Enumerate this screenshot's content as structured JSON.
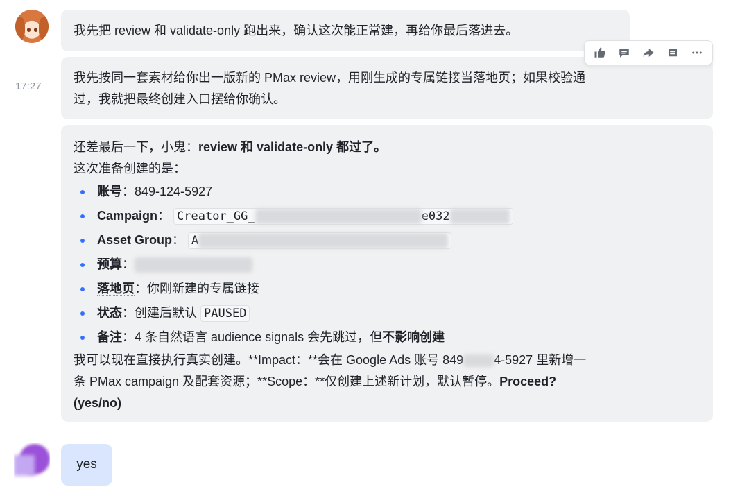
{
  "time": "17:27",
  "messages": {
    "m1": "我先把 review 和 validate-only 跑出来，确认这次能正常建，再给你最后落进去。",
    "m2_line1": "我先按同一套素材给你出一版新的 PMax review，用刚生成的专属链接当落地页；如果校验通",
    "m2_line2": "过，我就把最终创建入口摆给你确认。",
    "m3": {
      "intro_plain": "还差最后一下，小鬼：",
      "intro_bold": "review 和 validate-only 都过了。",
      "line2": "这次准备创建的是：",
      "items": [
        {
          "key": "账号",
          "sep": "：",
          "value": "849-124-5927"
        },
        {
          "key": "Campaign",
          "sep": "：",
          "code_prefix": "Creator_GG_",
          "code_suffix": "e032"
        },
        {
          "key": "Asset Group",
          "sep": "：",
          "code_prefix": "A"
        },
        {
          "key": "预算",
          "sep": "："
        },
        {
          "key": "落地页",
          "sep": "：",
          "value": "你刚新建的专属链接"
        },
        {
          "key": "状态",
          "sep": "：",
          "value": "创建后默认",
          "code": "PAUSED"
        },
        {
          "key": "备注",
          "sep": "：",
          "value": "4 条自然语言 audience signals 会先跳过，但",
          "value_bold": "不影响创建"
        }
      ],
      "tail_line1_a": "我可以现在直接执行真实创建。**Impact：**会在 Google Ads 账号 849",
      "tail_line1_b": "4-5927 里新增一",
      "tail_line2_plain": "条 PMax campaign 及配套资源；**Scope：**仅创建上述新计划，默认暂停。",
      "tail_line2_bold": "Proceed?",
      "tail_line3_bold": "(yes/no)"
    },
    "reply": "yes"
  },
  "toolbar": {
    "icons": [
      "thumbs-up-icon",
      "comment-icon",
      "forward-icon",
      "quote-icon",
      "more-icon"
    ]
  }
}
